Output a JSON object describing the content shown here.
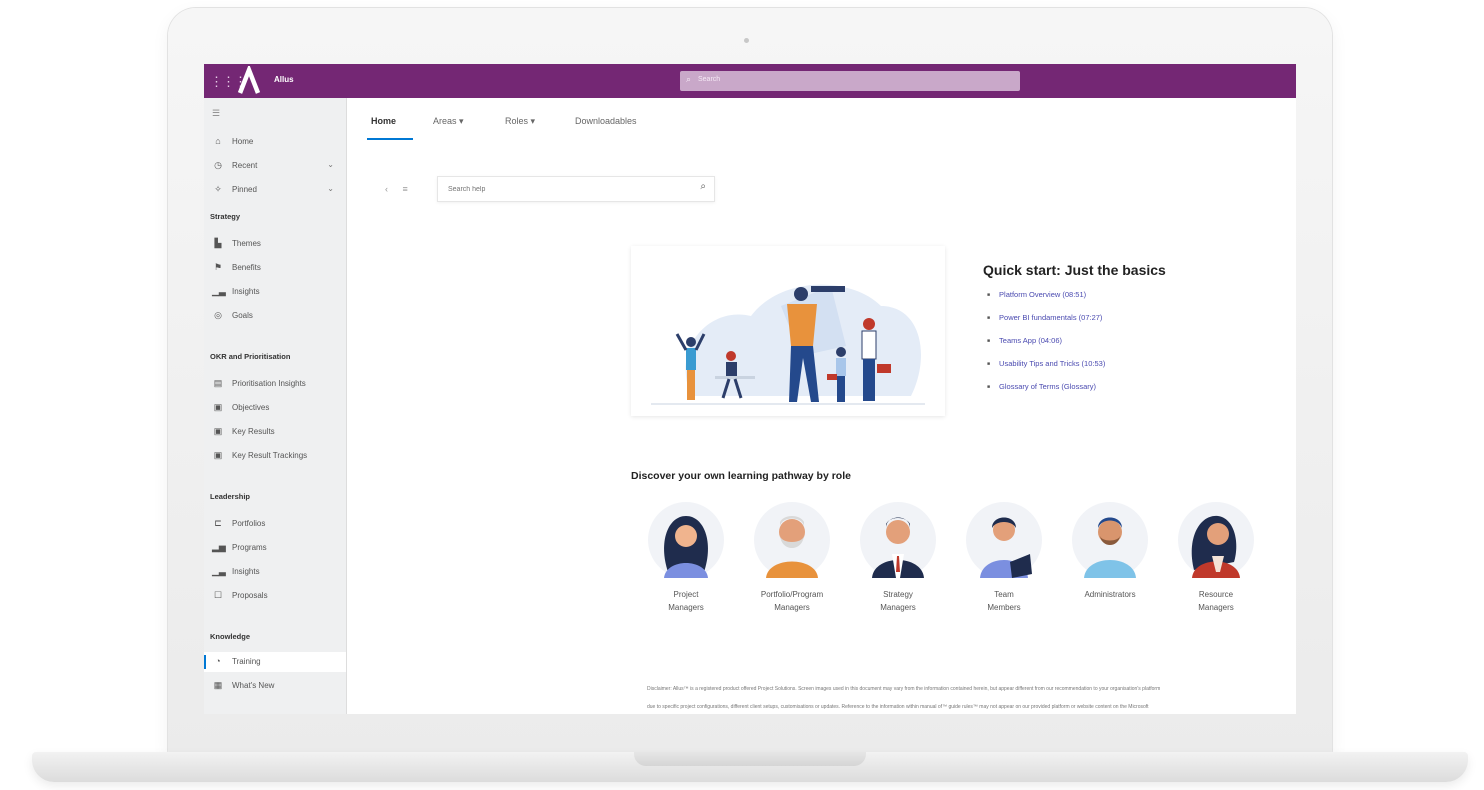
{
  "app": {
    "name": "Allus",
    "search_placeholder": "Search"
  },
  "sidebar": {
    "top_items": [
      {
        "icon": "home-icon",
        "label": "Home",
        "has_chevron": false
      },
      {
        "icon": "clock-icon",
        "label": "Recent",
        "has_chevron": true
      },
      {
        "icon": "pin-icon",
        "label": "Pinned",
        "has_chevron": true
      }
    ],
    "sections": [
      {
        "title": "Strategy",
        "items": [
          {
            "icon": "theme-icon",
            "label": "Themes"
          },
          {
            "icon": "benefits-icon",
            "label": "Benefits"
          },
          {
            "icon": "chart-icon",
            "label": "Insights"
          },
          {
            "icon": "goals-icon",
            "label": "Goals"
          }
        ]
      },
      {
        "title": "OKR and Prioritisation",
        "items": [
          {
            "icon": "list-icon",
            "label": "Prioritisation Insights"
          },
          {
            "icon": "objective-icon",
            "label": "Objectives"
          },
          {
            "icon": "key-results-icon",
            "label": "Key Results"
          },
          {
            "icon": "tracking-icon",
            "label": "Key Result Trackings"
          }
        ]
      },
      {
        "title": "Leadership",
        "items": [
          {
            "icon": "portfolio-icon",
            "label": "Portfolios"
          },
          {
            "icon": "program-icon",
            "label": "Programs"
          },
          {
            "icon": "chart-icon",
            "label": "Insights"
          },
          {
            "icon": "proposal-icon",
            "label": "Proposals"
          }
        ]
      },
      {
        "title": "Knowledge",
        "items": [
          {
            "icon": "training-icon",
            "label": "Training",
            "active": true
          },
          {
            "icon": "news-icon",
            "label": "What's New"
          }
        ]
      }
    ]
  },
  "tabs": [
    {
      "label": "Home",
      "active": true
    },
    {
      "label": "Areas ▾",
      "active": false
    },
    {
      "label": "Roles ▾",
      "active": false
    },
    {
      "label": "Downloadables",
      "active": false
    }
  ],
  "help_search": {
    "placeholder": "Search help"
  },
  "quick_start": {
    "title": "Quick start: Just the basics",
    "links": [
      "Platform Overview (08:51)",
      "Power BI fundamentals (07:27)",
      "Teams App (04:06)",
      "Usability Tips and Tricks (10:53)",
      "Glossary of Terms (Glossary)"
    ]
  },
  "discover": {
    "title": "Discover your own learning pathway by role",
    "roles": [
      {
        "line1": "Project",
        "line2": "Managers"
      },
      {
        "line1": "Portfolio/Program",
        "line2": "Managers"
      },
      {
        "line1": "Strategy",
        "line2": "Managers"
      },
      {
        "line1": "Team",
        "line2": "Members"
      },
      {
        "line1": "Administrators",
        "line2": ""
      },
      {
        "line1": "Resource",
        "line2": "Managers"
      }
    ]
  },
  "footer": {
    "line1": "Disclaimer: Allus™ is a registered product offered Project Solutions. Screen images used in this document may vary from the information contained herein, but appear different from our recommendation to your organisation's platform",
    "line2": "due to specific project configurations, different client setups, customisations or updates. Reference to the information within manual of™ guide rules™ may not appear on our provided platform or website content on the Microsoft"
  },
  "colors": {
    "header": "#742774",
    "accent": "#0078d4",
    "link": "#4a4ab0"
  }
}
